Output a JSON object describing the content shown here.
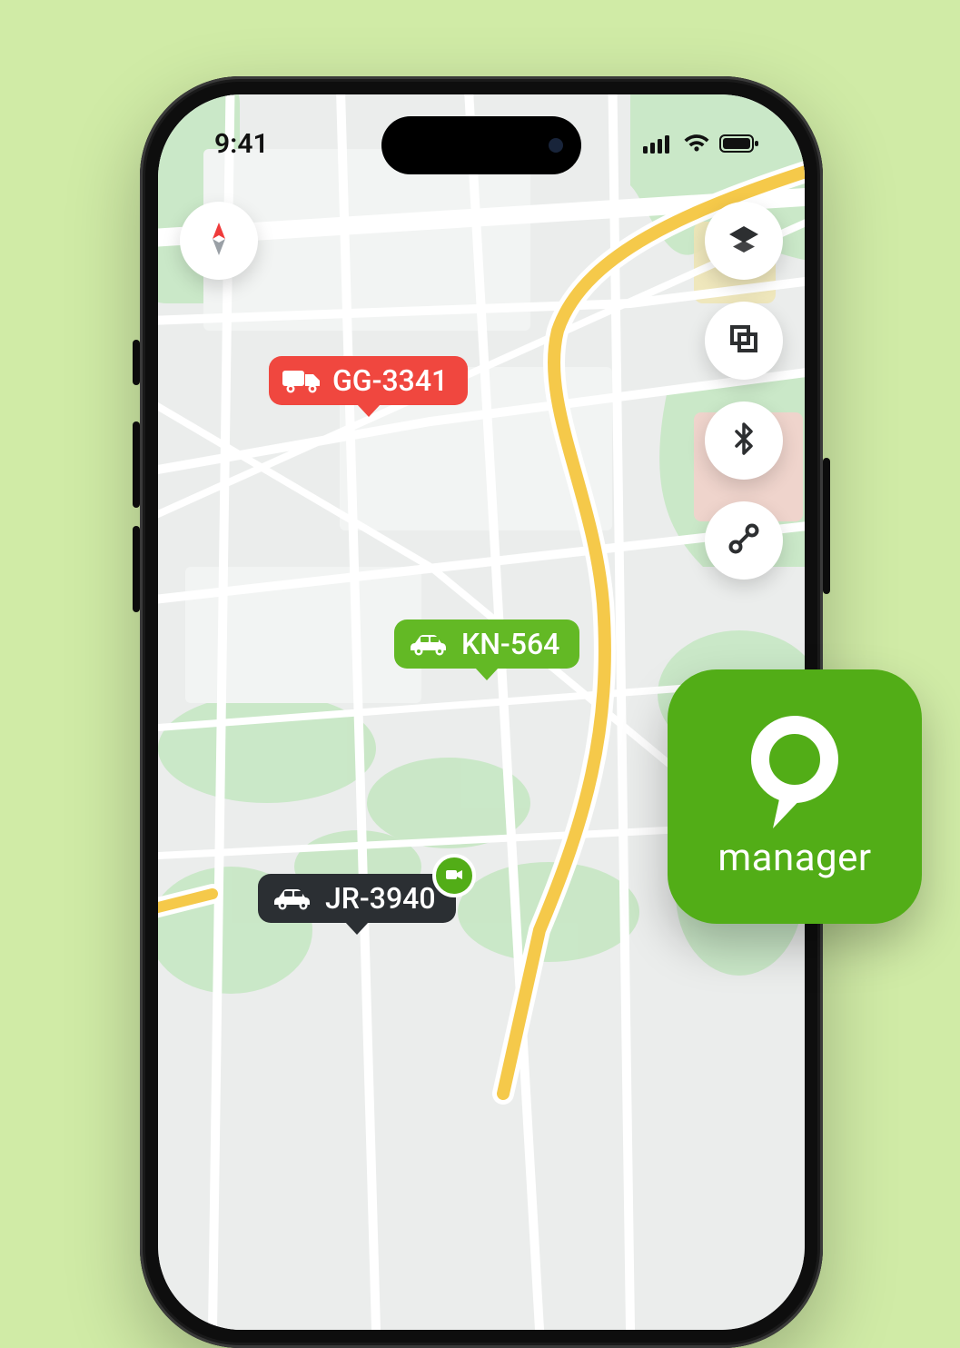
{
  "status": {
    "time": "9:41"
  },
  "vehicles": [
    {
      "id": "GG-3341",
      "color": "red",
      "type": "truck",
      "has_camera": false
    },
    {
      "id": "KN-564",
      "color": "green",
      "type": "car",
      "has_camera": false
    },
    {
      "id": "JR-3940",
      "color": "dark",
      "type": "car",
      "has_camera": true
    }
  ],
  "app_badge": {
    "label": "manager"
  },
  "colors": {
    "background": "#d0eba6",
    "pin_red": "#f0473f",
    "pin_green": "#63b925",
    "pin_dark": "#2b2f33",
    "brand_green": "#52ad17"
  }
}
